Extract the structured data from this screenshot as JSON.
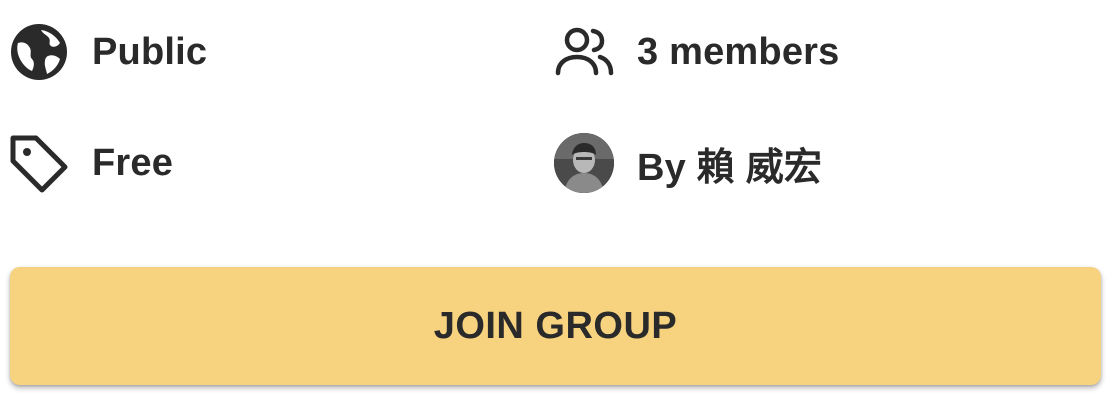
{
  "group_info": {
    "privacy": {
      "label": "Public",
      "icon": "globe-icon"
    },
    "members": {
      "label": "3 members",
      "icon": "users-icon"
    },
    "price": {
      "label": "Free",
      "icon": "tag-icon"
    },
    "owner": {
      "label": "By 賴 威宏",
      "icon": "avatar"
    }
  },
  "actions": {
    "join_label": "JOIN GROUP"
  },
  "colors": {
    "button_bg": "#f7d380",
    "text": "#2a2a2a"
  }
}
